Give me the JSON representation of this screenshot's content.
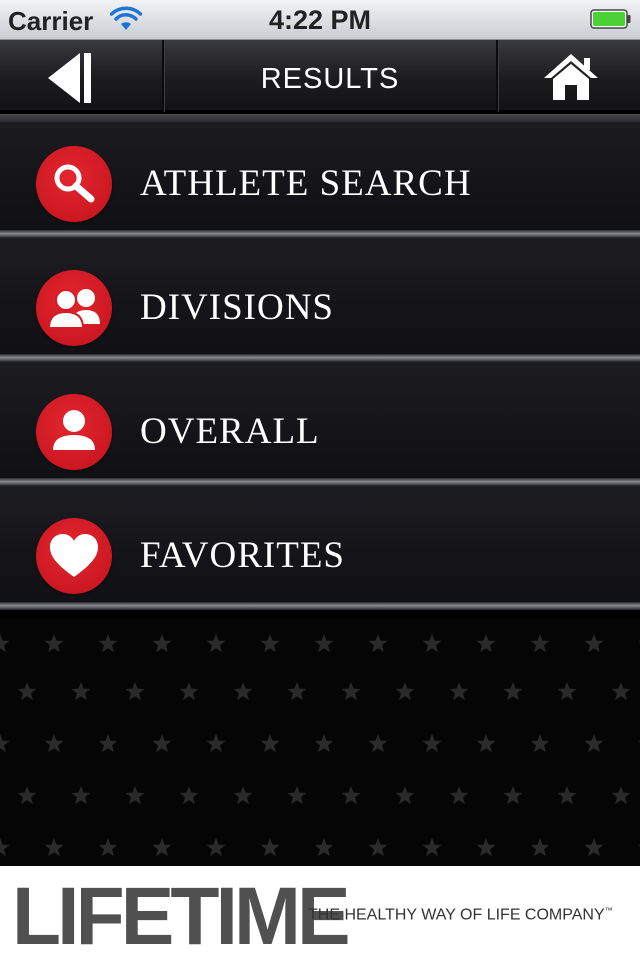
{
  "status_bar": {
    "carrier": "Carrier",
    "time": "4:22 PM",
    "battery_color": "#4cd137"
  },
  "nav": {
    "title": "RESULTS",
    "back_icon": "back-arrow-icon",
    "home_icon": "home-icon"
  },
  "menu": {
    "items": [
      {
        "label": "ATHLETE SEARCH",
        "icon": "search-icon"
      },
      {
        "label": "DIVISIONS",
        "icon": "group-icon"
      },
      {
        "label": "OVERALL",
        "icon": "person-icon"
      },
      {
        "label": "FAVORITES",
        "icon": "heart-icon"
      }
    ]
  },
  "colors": {
    "accent_red": "#d81a24",
    "menu_bg": "#151519",
    "text": "#ffffff"
  },
  "footer": {
    "brand": "LIFETIME",
    "tagline": "THE HEALTHY WAY OF LIFE COMPANY",
    "trademark": "™"
  }
}
